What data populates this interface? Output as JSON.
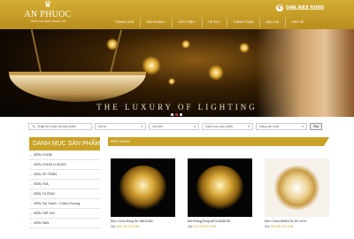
{
  "logo": {
    "icon": "crown-icon",
    "brand": "AN PHUOC",
    "tagline": "TỔNG KHO ĐÈN TRANG TRÍ"
  },
  "hotline": {
    "icon": "phone-icon",
    "number": "096.883.5050"
  },
  "nav": [
    "TRANG CHỦ",
    "SẢN PHẨM ▾",
    "GIỚI THIỆU",
    "TIN TỨC",
    "THANH TOÁN",
    "BÁO GIÁ",
    "LIÊN HỆ"
  ],
  "banner": {
    "title": "THE LUXURY OF LIGHTING",
    "slide_count": 3,
    "active_slide": 2
  },
  "search": {
    "keyword_placeholder": "Nhập tên hoặc mã sản phẩm",
    "price_from": "Giá từ",
    "price_to": "Giá đến",
    "category": "Danh mục sản phẩm",
    "brand": "Hãng sản xuất",
    "button": "Tìm"
  },
  "sidebar": {
    "title": "DANH MỤC SẢN PHẨM",
    "items": [
      "ĐÈN CHÙM",
      "ĐÈN CHÙM LUXURY",
      "ĐÈN ỐP TRẦN",
      "ĐÈN THẢ",
      "ĐÈN TƯỜNG",
      "ĐÈN Soi Tranh - Chiếu Gương",
      "ĐÈN TRẺ EM",
      "ĐÈN SÂN"
    ]
  },
  "section": {
    "title": "ĐÈN CHÙM"
  },
  "products": [
    {
      "name": "Đèn Chùm Đồng Sứ HB011/81",
      "price_label": "Giá:",
      "price": "164,738,000 VNĐ"
    },
    {
      "name": "ĐènThủngTinng APOL8080/36",
      "price_label": "Giá:",
      "price": "102,675,000 VNĐ"
    },
    {
      "name": "Đèn Chùm AP80176-16+12+6",
      "price_label": "Giá:",
      "price": "163,000,000 VNĐ"
    }
  ],
  "colors": {
    "accent": "#c9a227"
  }
}
